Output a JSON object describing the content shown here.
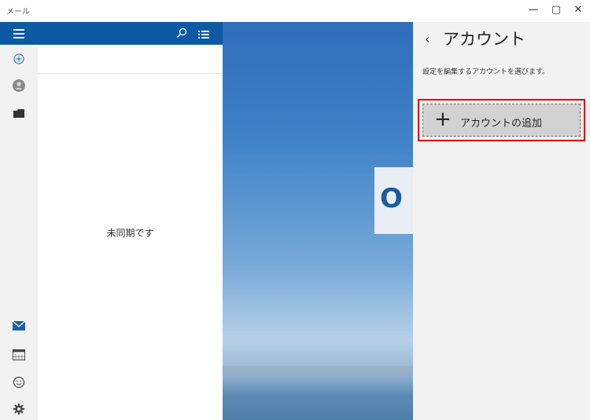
{
  "window": {
    "app_title": "メール",
    "minimize_glyph": "—",
    "maximize_glyph": "▢",
    "close_glyph": "✕"
  },
  "list_pane": {
    "empty_message": "未同期です"
  },
  "account_panel": {
    "back_glyph": "‹",
    "title": "アカウント",
    "description": "設定を編集するアカウントを選びます。",
    "add_account_icon": "+",
    "add_account_label": "アカウントの追加"
  },
  "brand": {
    "outlook_letter": "O"
  },
  "icons": [
    "hamburger-icon",
    "compose-icon",
    "account-icon",
    "folder-icon",
    "search-icon",
    "filter-icon",
    "mail-icon",
    "calendar-icon",
    "feedback-icon",
    "settings-icon"
  ],
  "colors": {
    "accent": "#0b5aa3",
    "highlight": "#e00000"
  }
}
